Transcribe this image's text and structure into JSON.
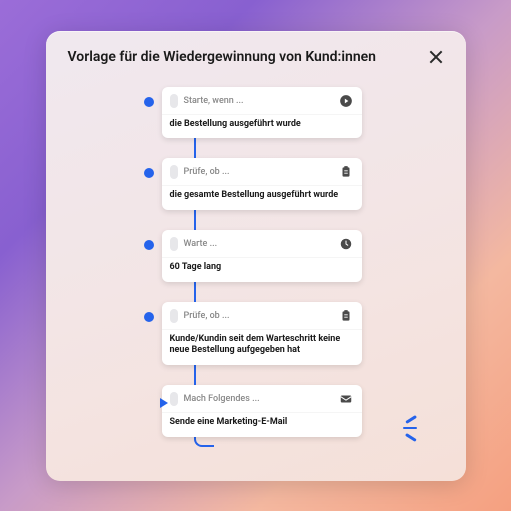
{
  "title": "Vorlage für die Wiedergewinnung von Kund:innen",
  "steps": [
    {
      "label": "Starte, wenn ...",
      "text": "die Bestellung ausgeführt wurde",
      "icon": "play"
    },
    {
      "label": "Prüfe, ob ...",
      "text": "die gesamte Bestellung ausgeführt wurde",
      "icon": "clipboard"
    },
    {
      "label": "Warte ...",
      "text": "60 Tage lang",
      "icon": "clock"
    },
    {
      "label": "Prüfe, ob ...",
      "text": "Kunde/Kundin seit dem Warteschritt keine neue Bestellung aufgegeben hat",
      "icon": "clipboard"
    },
    {
      "label": "Mach Folgendes ...",
      "text": "Sende eine Marketing-E-Mail",
      "icon": "mail"
    }
  ]
}
